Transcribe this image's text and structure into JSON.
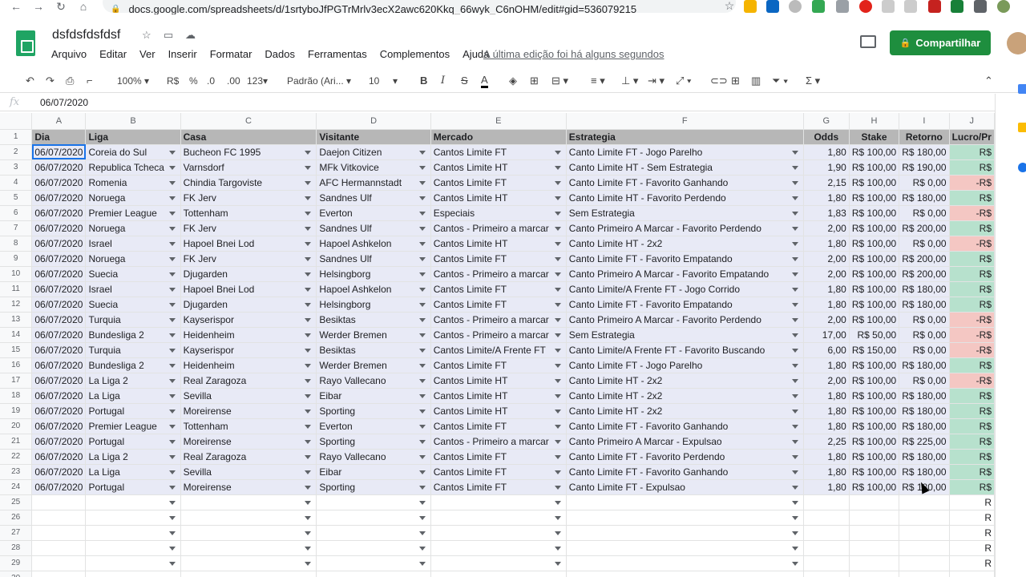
{
  "browser": {
    "url": "docs.google.com/spreadsheets/d/1srtyboJfPGTrMrlv3ecX2awc620Kkq_66wyk_C6nOHM/edit#gid=536079215"
  },
  "doc": {
    "title": "dsfdsfdsfdsf",
    "menu": [
      "Arquivo",
      "Editar",
      "Ver",
      "Inserir",
      "Formatar",
      "Dados",
      "Ferramentas",
      "Complementos",
      "Ajuda"
    ],
    "last_edit": "A última edição foi há alguns segundos",
    "share_label": "Compartilhar"
  },
  "toolbar": {
    "zoom": "100%",
    "currency": "R$",
    "percent": "%",
    "dec_less": ".0",
    "dec_more": ".00",
    "format": "123",
    "font": "Padrão (Ari...",
    "font_size": "10",
    "bold": "B",
    "italic": "I",
    "strike": "S",
    "text_color": "A",
    "sum": "Σ"
  },
  "formula_bar": {
    "label": "fx",
    "value": "06/07/2020"
  },
  "columns": [
    "A",
    "B",
    "C",
    "D",
    "E",
    "F",
    "G",
    "H",
    "I",
    "J"
  ],
  "headers": [
    "Dia",
    "Liga",
    "Casa",
    "Visitante",
    "Mercado",
    "Estrategia",
    "Odds",
    "Stake",
    "Retorno",
    "Lucro/Pr"
  ],
  "rows": [
    [
      "06/07/2020",
      "Coreia do Sul",
      "Bucheon FC 1995",
      "Daejon Citizen",
      "Cantos Limite FT",
      "Canto Limite FT - Jogo Parelho",
      "1,80",
      "R$ 100,00",
      "R$ 180,00",
      "R$"
    ],
    [
      "06/07/2020",
      "Republica Tcheca",
      "Varnsdorf",
      "MFk Vitkovice",
      "Cantos Limite HT",
      "Canto Limite HT - Sem Estrategia",
      "1,90",
      "R$ 100,00",
      "R$ 190,00",
      "R$"
    ],
    [
      "06/07/2020",
      "Romenia",
      "Chindia Targoviste",
      "AFC Hermannstadt",
      "Cantos Limite FT",
      "Canto Limite FT - Favorito Ganhando",
      "2,15",
      "R$ 100,00",
      "R$ 0,00",
      "-R$"
    ],
    [
      "06/07/2020",
      "Noruega",
      "FK Jerv",
      "Sandnes Ulf",
      "Cantos Limite HT",
      "Canto Limite HT - Favorito Perdendo",
      "1,80",
      "R$ 100,00",
      "R$ 180,00",
      "R$"
    ],
    [
      "06/07/2020",
      "Premier League",
      "Tottenham",
      "Everton",
      "Especiais",
      "Sem Estrategia",
      "1,83",
      "R$ 100,00",
      "R$ 0,00",
      "-R$"
    ],
    [
      "06/07/2020",
      "Noruega",
      "FK Jerv",
      "Sandnes Ulf",
      "Cantos - Primeiro a marcar",
      "Canto Primeiro A Marcar - Favorito Perdendo",
      "2,00",
      "R$ 100,00",
      "R$ 200,00",
      "R$"
    ],
    [
      "06/07/2020",
      "Israel",
      "Hapoel Bnei Lod",
      "Hapoel Ashkelon",
      "Cantos Limite HT",
      "Canto Limite HT - 2x2",
      "1,80",
      "R$ 100,00",
      "R$ 0,00",
      "-R$"
    ],
    [
      "06/07/2020",
      "Noruega",
      "FK Jerv",
      "Sandnes Ulf",
      "Cantos Limite FT",
      "Canto Limite FT - Favorito Empatando",
      "2,00",
      "R$ 100,00",
      "R$ 200,00",
      "R$"
    ],
    [
      "06/07/2020",
      "Suecia",
      "Djugarden",
      "Helsingborg",
      "Cantos - Primeiro a marcar",
      "Canto Primeiro A Marcar - Favorito Empatando",
      "2,00",
      "R$ 100,00",
      "R$ 200,00",
      "R$"
    ],
    [
      "06/07/2020",
      "Israel",
      "Hapoel Bnei Lod",
      "Hapoel Ashkelon",
      "Cantos Limite FT",
      "Canto Limite/A Frente FT - Jogo Corrido",
      "1,80",
      "R$ 100,00",
      "R$ 180,00",
      "R$"
    ],
    [
      "06/07/2020",
      "Suecia",
      "Djugarden",
      "Helsingborg",
      "Cantos Limite FT",
      "Canto Limite FT - Favorito Empatando",
      "1,80",
      "R$ 100,00",
      "R$ 180,00",
      "R$"
    ],
    [
      "06/07/2020",
      "Turquia",
      "Kayserispor",
      "Besiktas",
      "Cantos - Primeiro a marcar",
      "Canto Primeiro A Marcar - Favorito Perdendo",
      "2,00",
      "R$ 100,00",
      "R$ 0,00",
      "-R$"
    ],
    [
      "06/07/2020",
      "Bundesliga 2",
      "Heidenheim",
      "Werder Bremen",
      "Cantos - Primeiro a marcar",
      "Sem Estrategia",
      "17,00",
      "R$ 50,00",
      "R$ 0,00",
      "-R$"
    ],
    [
      "06/07/2020",
      "Turquia",
      "Kayserispor",
      "Besiktas",
      "Cantos Limite/A Frente FT",
      "Canto Limite/A Frente FT - Favorito Buscando",
      "6,00",
      "R$ 150,00",
      "R$ 0,00",
      "-R$"
    ],
    [
      "06/07/2020",
      "Bundesliga 2",
      "Heidenheim",
      "Werder Bremen",
      "Cantos Limite FT",
      "Canto Limite FT - Jogo Parelho",
      "1,80",
      "R$ 100,00",
      "R$ 180,00",
      "R$"
    ],
    [
      "06/07/2020",
      "La Liga 2",
      "Real Zaragoza",
      "Rayo Vallecano",
      "Cantos Limite HT",
      "Canto Limite HT - 2x2",
      "2,00",
      "R$ 100,00",
      "R$ 0,00",
      "-R$"
    ],
    [
      "06/07/2020",
      "La Liga",
      "Sevilla",
      "Eibar",
      "Cantos Limite HT",
      "Canto Limite HT - 2x2",
      "1,80",
      "R$ 100,00",
      "R$ 180,00",
      "R$"
    ],
    [
      "06/07/2020",
      "Portugal",
      "Moreirense",
      "Sporting",
      "Cantos Limite HT",
      "Canto Limite HT - 2x2",
      "1,80",
      "R$ 100,00",
      "R$ 180,00",
      "R$"
    ],
    [
      "06/07/2020",
      "Premier League",
      "Tottenham",
      "Everton",
      "Cantos Limite FT",
      "Canto Limite FT - Favorito Ganhando",
      "1,80",
      "R$ 100,00",
      "R$ 180,00",
      "R$"
    ],
    [
      "06/07/2020",
      "Portugal",
      "Moreirense",
      "Sporting",
      "Cantos - Primeiro a marcar",
      "Canto Primeiro A Marcar - Expulsao",
      "2,25",
      "R$ 100,00",
      "R$ 225,00",
      "R$"
    ],
    [
      "06/07/2020",
      "La Liga 2",
      "Real Zaragoza",
      "Rayo Vallecano",
      "Cantos Limite FT",
      "Canto Limite FT - Favorito Perdendo",
      "1,80",
      "R$ 100,00",
      "R$ 180,00",
      "R$"
    ],
    [
      "06/07/2020",
      "La Liga",
      "Sevilla",
      "Eibar",
      "Cantos Limite FT",
      "Canto Limite FT - Favorito Ganhando",
      "1,80",
      "R$ 100,00",
      "R$ 180,00",
      "R$"
    ],
    [
      "06/07/2020",
      "Portugal",
      "Moreirense",
      "Sporting",
      "Cantos Limite FT",
      "Canto Limite FT - Expulsao",
      "1,80",
      "R$ 100,00",
      "R$ 180,00",
      "R$"
    ]
  ],
  "empty_rows": [
    {
      "num": "25",
      "tail": "R"
    },
    {
      "num": "26",
      "tail": "R"
    },
    {
      "num": "27",
      "tail": "R"
    },
    {
      "num": "28",
      "tail": "R"
    },
    {
      "num": "29",
      "tail": "R"
    },
    {
      "num": "30",
      "tail": ""
    }
  ],
  "colors": {
    "positive": "#b7e1cd",
    "negative": "#f4c7c3",
    "row_band": "#e8eaf6",
    "header_band": "#b7b7b7",
    "share_green": "#1e8e3e"
  }
}
